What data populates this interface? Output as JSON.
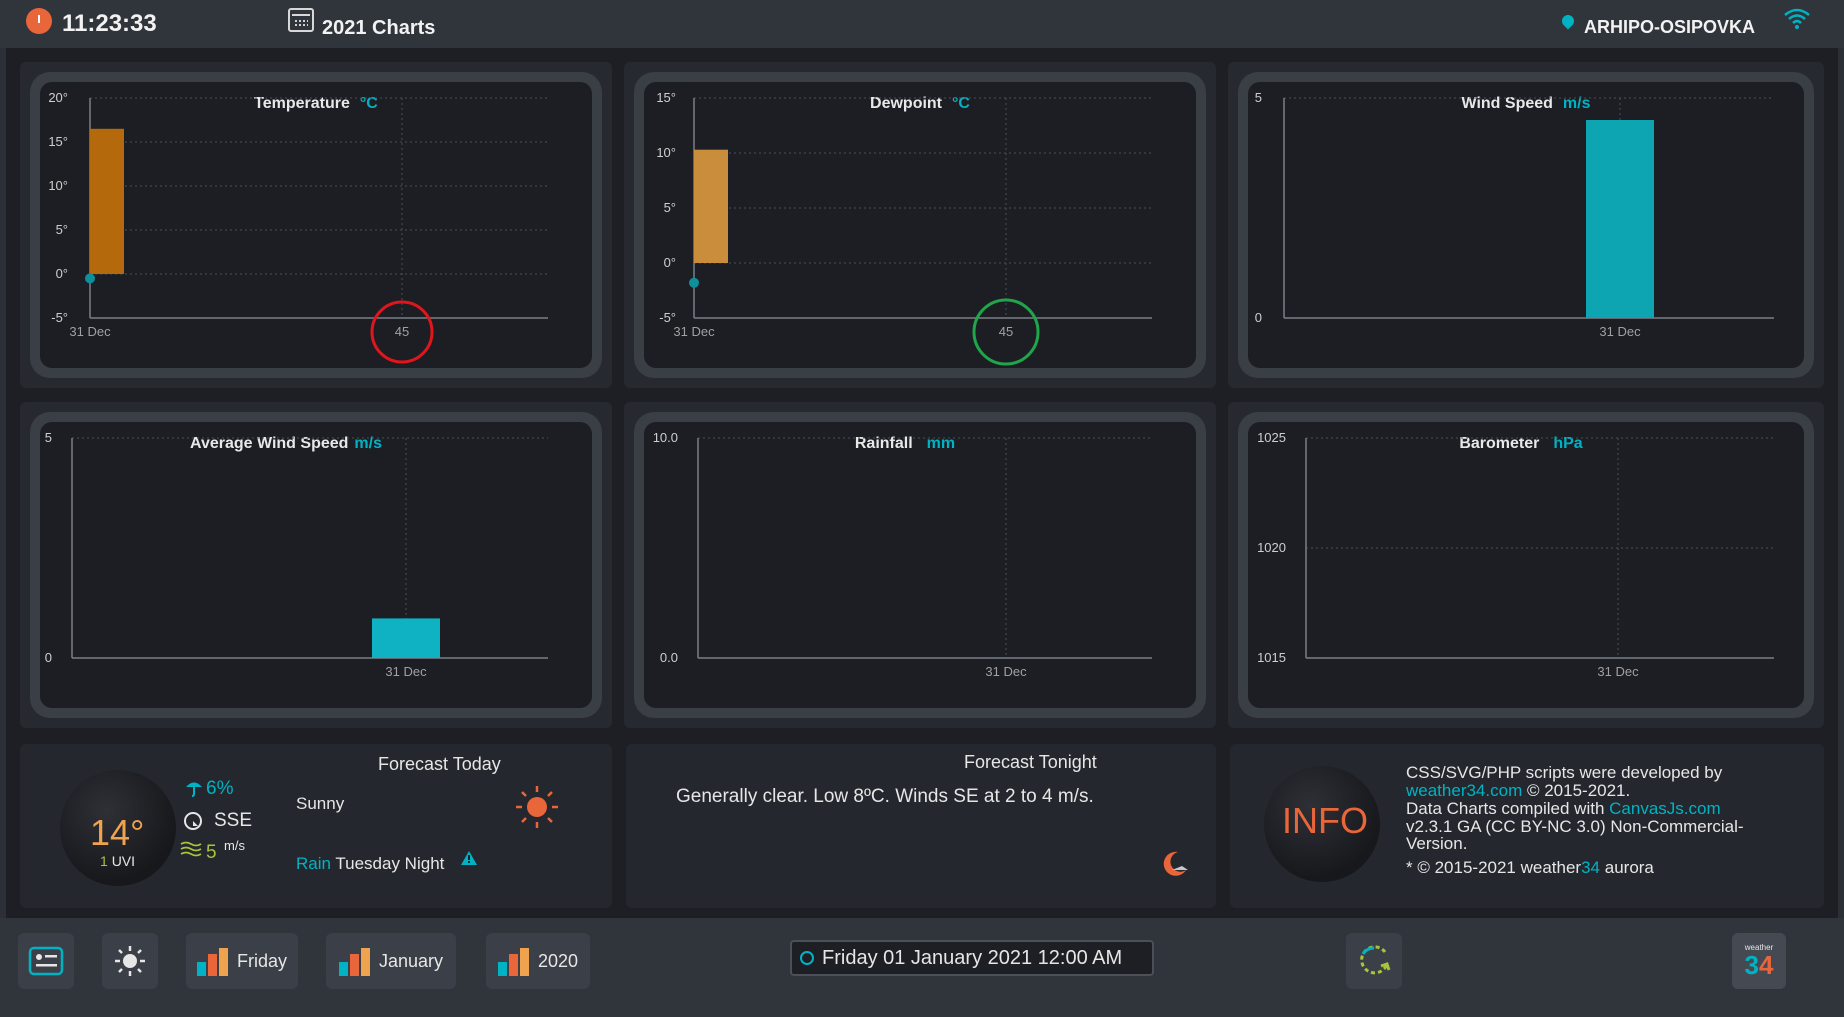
{
  "topbar": {
    "time": "11:23:33",
    "title": "2021 Charts",
    "location": "ARHIPO-OSIPOVKA"
  },
  "charts": {
    "temperature": {
      "title": "Temperature",
      "unit": "°C",
      "y_ticks": [
        "20°",
        "15°",
        "10°",
        "5°",
        "0°",
        "-5°"
      ],
      "x_ticks": [
        "31 Dec",
        "45"
      ]
    },
    "dewpoint": {
      "title": "Dewpoint",
      "unit": "°C",
      "y_ticks": [
        "15°",
        "10°",
        "5°",
        "0°",
        "-5°"
      ],
      "x_ticks": [
        "31 Dec",
        "45"
      ]
    },
    "wind_speed": {
      "title": "Wind Speed",
      "unit": "m/s",
      "y_ticks": [
        "5",
        "0"
      ],
      "x_ticks": [
        "31 Dec"
      ]
    },
    "avg_wind_speed": {
      "title": "Average Wind Speed",
      "unit": "m/s",
      "y_ticks": [
        "5",
        "0"
      ],
      "x_ticks": [
        "31 Dec"
      ]
    },
    "rainfall": {
      "title": "Rainfall",
      "unit": "mm",
      "y_ticks": [
        "10.0",
        "0.0"
      ],
      "x_ticks": [
        "31 Dec"
      ]
    },
    "barometer": {
      "title": "Barometer",
      "unit": "hPa",
      "y_ticks": [
        "1025",
        "1020",
        "1015"
      ],
      "x_ticks": [
        "31 Dec"
      ]
    }
  },
  "chart_data": [
    {
      "type": "bar",
      "title": "Temperature",
      "categories": [
        "31 Dec"
      ],
      "ranges": [
        [
          0,
          16.5
        ]
      ],
      "low_point": -0.5,
      "ylim": [
        -5,
        20
      ],
      "color": "#b3690c"
    },
    {
      "type": "bar",
      "title": "Dewpoint",
      "categories": [
        "31 Dec"
      ],
      "ranges": [
        [
          0,
          10.3
        ]
      ],
      "low_point": -1.8,
      "ylim": [
        -5,
        15
      ],
      "color": "#c98d3c"
    },
    {
      "type": "bar",
      "title": "Wind Speed",
      "categories": [
        "31 Dec"
      ],
      "values": [
        4.5
      ],
      "ylim": [
        0,
        5
      ],
      "color": "#0ea5b3"
    },
    {
      "type": "bar",
      "title": "Average Wind Speed",
      "categories": [
        "31 Dec"
      ],
      "values": [
        0.9
      ],
      "ylim": [
        0,
        5
      ],
      "color": "#0eb2c2"
    },
    {
      "type": "bar",
      "title": "Rainfall",
      "categories": [
        "31 Dec"
      ],
      "values": [
        0
      ],
      "ylim": [
        0,
        10
      ]
    },
    {
      "type": "line",
      "title": "Barometer",
      "categories": [
        "31 Dec"
      ],
      "values": [],
      "ylim": [
        1015,
        1025
      ]
    }
  ],
  "forecast_today": {
    "heading": "Forecast Today",
    "temp": "14°",
    "uvi_value": "1",
    "uvi_label": "UVI",
    "rain_chance": "6%",
    "wind_dir": "SSE",
    "wind_speed": "5",
    "wind_unit": "m/s",
    "condition": "Sunny",
    "rain_label": "Rain",
    "rain_when": "Tuesday Night"
  },
  "forecast_tonight": {
    "heading": "Forecast Tonight",
    "text": "Generally clear. Low 8ºC. Winds SE at 2 to 4 m/s."
  },
  "info": {
    "badge": "INFO",
    "line1": "CSS/SVG/PHP scripts were developed by",
    "link1": "weather34.com",
    "line1b": "© 2015-2021.",
    "line2": "Data Charts compiled with",
    "link2": "CanvasJs.com",
    "line3": "v2.3.1 GA (CC BY-NC 3.0) Non-Commercial-",
    "line4": "Version.",
    "line5a": "* © 2015-2021 weather",
    "line5b": "34",
    "line5c": "aurora"
  },
  "bottombar": {
    "btn_friday": "Friday",
    "btn_january": "January",
    "btn_2020": "2020",
    "datetime": "Friday 01 January 2021 12:00 AM",
    "logo_small": "weather",
    "logo_big": "34"
  }
}
